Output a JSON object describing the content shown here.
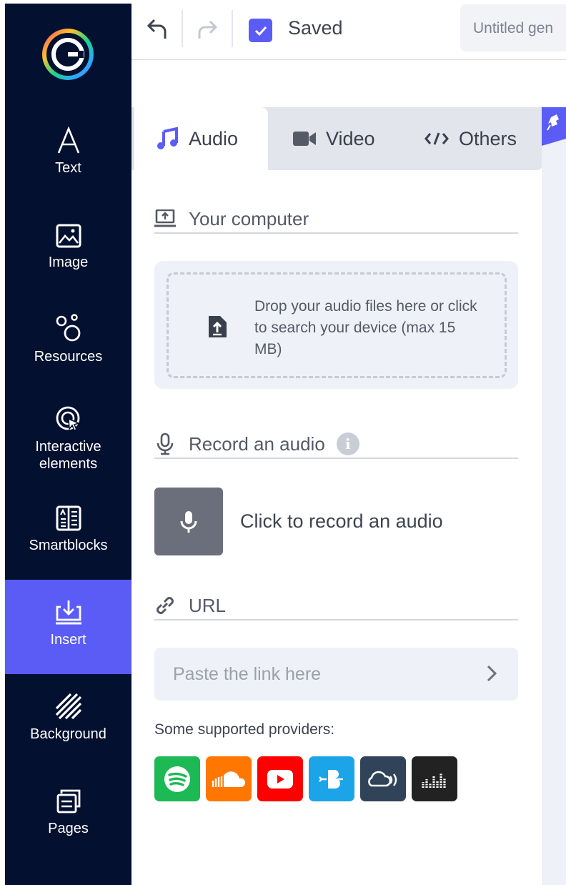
{
  "sidebar": {
    "items": [
      {
        "icon": "text-icon",
        "label": "Text"
      },
      {
        "icon": "image-icon",
        "label": "Image"
      },
      {
        "icon": "resources-icon",
        "label": "Resources"
      },
      {
        "icon": "interactive-icon",
        "label": "Interactive elements"
      },
      {
        "icon": "smartblocks-icon",
        "label": "Smartblocks"
      },
      {
        "icon": "insert-icon",
        "label": "Insert",
        "active": true
      },
      {
        "icon": "background-icon",
        "label": "Background"
      },
      {
        "icon": "pages-icon",
        "label": "Pages"
      }
    ],
    "active_color": "#5b5cf6",
    "background_color": "#03102f"
  },
  "toolbar": {
    "saved_label": "Saved",
    "saved_checked": true,
    "doc_title": "Untitled gen"
  },
  "tabs": [
    {
      "label": "Audio",
      "icon": "music-note-icon",
      "active": true
    },
    {
      "label": "Video",
      "icon": "video-camera-icon",
      "active": false
    },
    {
      "label": "Others",
      "icon": "code-icon",
      "active": false
    }
  ],
  "computer": {
    "heading": "Your computer",
    "drop_text": "Drop your audio files here or click to search your device (max 15 MB)"
  },
  "record": {
    "heading": "Record an audio",
    "button_text": "Click to record an audio"
  },
  "url": {
    "heading": "URL",
    "placeholder": "Paste the link here"
  },
  "providers": {
    "label": "Some supported providers:",
    "items": [
      {
        "name": "spotify",
        "color": "#1db954"
      },
      {
        "name": "soundcloud",
        "color": "#ff7700"
      },
      {
        "name": "youtube",
        "color": "#ff0000"
      },
      {
        "name": "beatport",
        "color": "#1ba5e8"
      },
      {
        "name": "mixcloud",
        "color": "#314359"
      },
      {
        "name": "audio-bars",
        "color": "#222222"
      }
    ]
  }
}
